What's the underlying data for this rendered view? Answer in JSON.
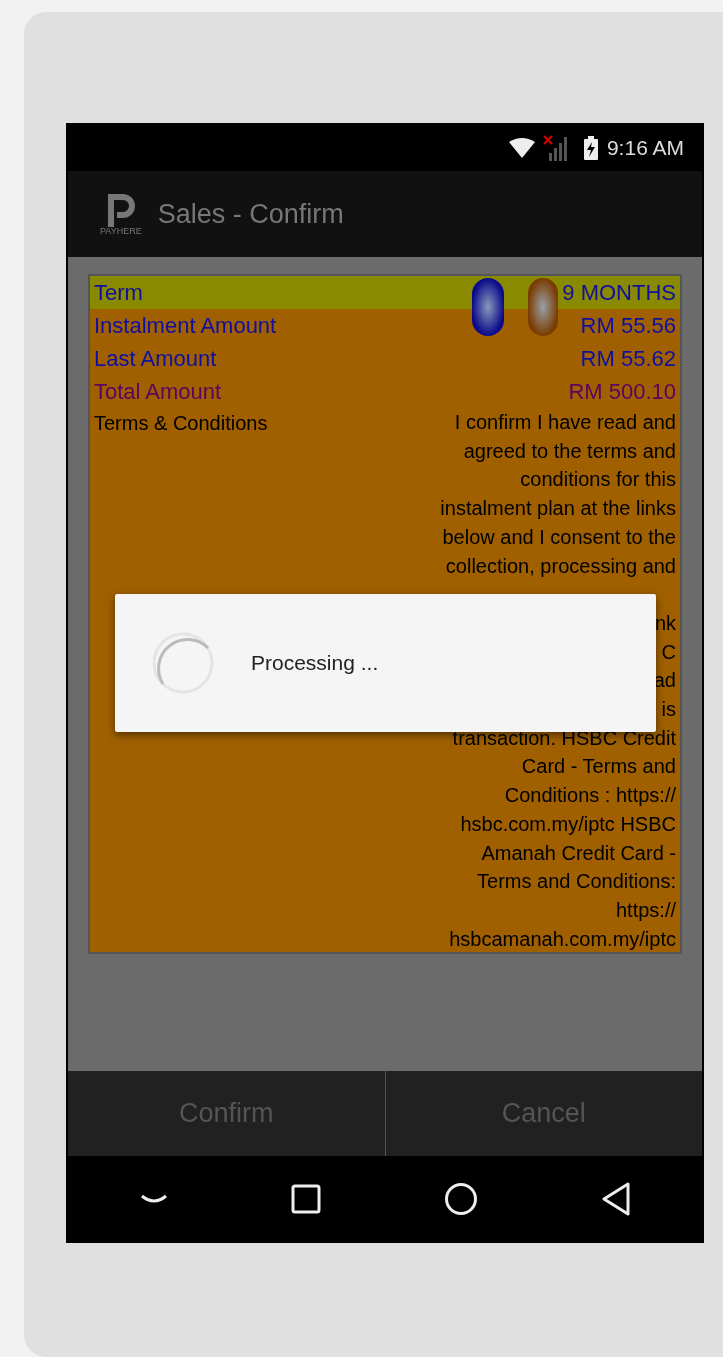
{
  "status_bar": {
    "time": "9:16 AM"
  },
  "app_bar": {
    "title": "Sales - Confirm",
    "logo_caption": "PAYHERE"
  },
  "details": [
    {
      "kind": "detail",
      "label": "Term",
      "value": "9 MONTHS",
      "selected": true
    },
    {
      "kind": "detail",
      "label": "Instalment Amount",
      "value": "RM 55.56",
      "selected": false
    },
    {
      "kind": "detail",
      "label": "Last Amount",
      "value": "RM 55.62",
      "selected": false
    },
    {
      "kind": "total",
      "label": "Total Amount",
      "value": "RM 500.10",
      "selected": false
    }
  ],
  "terms": {
    "label": "Terms & Conditions",
    "lines_top": [
      "I confirm I have read and",
      "agreed to the terms and",
      "conditions for this",
      "instalment plan at the links",
      "below and I consent to the",
      "collection, processing and"
    ],
    "lines_bottom": [
      "nk",
      "C",
      "ad",
      "is",
      "transaction. HSBC Credit",
      "Card - Terms and",
      "Conditions : https://",
      "hsbc.com.my/iptc HSBC",
      "Amanah Credit Card -",
      "Terms and Conditions:",
      "https://",
      "hsbcamanah.com.my/iptc"
    ]
  },
  "dialog": {
    "message": "Processing ..."
  },
  "buttons": [
    {
      "label": "Confirm"
    },
    {
      "label": "Cancel"
    }
  ]
}
